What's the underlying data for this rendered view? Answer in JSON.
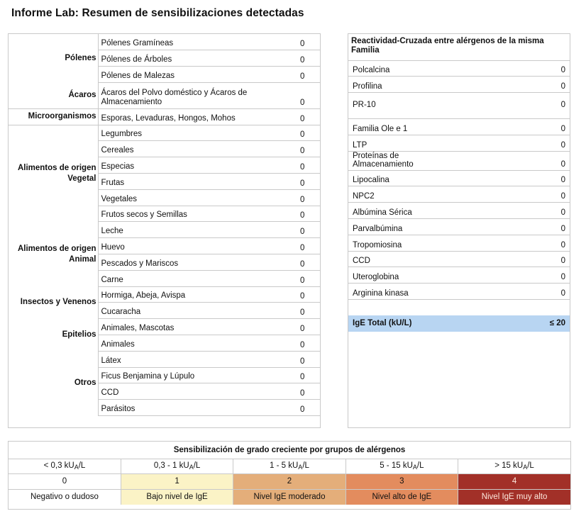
{
  "title": "Informe Lab: Resumen de sensibilizaciones detectadas",
  "left": {
    "rows": [
      {
        "cat": "",
        "sub": "Pólenes Gramíneas",
        "val": "0"
      },
      {
        "cat": "Pólenes",
        "sub": "Pólenes de Árboles",
        "val": "0"
      },
      {
        "cat": "",
        "sub": "Pólenes de Malezas",
        "val": "0"
      },
      {
        "cat": "Ácaros",
        "sub": "Ácaros del Polvo doméstico y Ácaros de Almacenamiento",
        "val": "0"
      },
      {
        "cat": "Microorganismos",
        "sub": "Esporas, Levaduras, Hongos, Mohos",
        "val": "0"
      },
      {
        "cat": "",
        "sub": "Legumbres",
        "val": "0"
      },
      {
        "cat": "",
        "sub": "Cereales",
        "val": "0"
      },
      {
        "cat": "Alimentos de origen Vegetal",
        "sub": "Especias",
        "val": "0"
      },
      {
        "cat": "",
        "sub": "Frutas",
        "val": "0"
      },
      {
        "cat": "",
        "sub": "Vegetales",
        "val": "0"
      },
      {
        "cat": "",
        "sub": "Frutos secos y Semillas",
        "val": "0"
      },
      {
        "cat": "",
        "sub": "Leche",
        "val": "0"
      },
      {
        "cat": "Alimentos de origen Animal",
        "sub": "Huevo",
        "val": "0"
      },
      {
        "cat": "",
        "sub": "Pescados y Mariscos",
        "val": "0"
      },
      {
        "cat": "",
        "sub": "Carne",
        "val": "0"
      },
      {
        "cat": "Insectos y Venenos",
        "sub": "Hormiga, Abeja, Avispa",
        "val": "0"
      },
      {
        "cat": "",
        "sub": "Cucaracha",
        "val": "0"
      },
      {
        "cat": "Epitelios",
        "sub": "Animales, Mascotas",
        "val": "0"
      },
      {
        "cat": "",
        "sub": "Animales",
        "val": "0"
      },
      {
        "cat": "",
        "sub": "Látex",
        "val": "0"
      },
      {
        "cat": "Otros",
        "sub": "Ficus Benjamina y Lúpulo",
        "val": "0"
      },
      {
        "cat": "",
        "sub": "CCD",
        "val": "0"
      },
      {
        "cat": "",
        "sub": "Parásitos",
        "val": "0"
      }
    ]
  },
  "right": {
    "header": "Reactividad-Cruzada entre alérgenos de la misma Familia",
    "rows": [
      {
        "name": "Polcalcina",
        "val": "0"
      },
      {
        "name": "Profilina",
        "val": "0"
      },
      {
        "name": "PR-10",
        "val": "0"
      },
      {
        "name": "Familia Ole e 1",
        "val": "0"
      },
      {
        "name": "LTP",
        "val": "0"
      },
      {
        "name": "Proteínas de Almacenamiento",
        "val": "0"
      },
      {
        "name": "Lipocalina",
        "val": "0"
      },
      {
        "name": "NPC2",
        "val": "0"
      },
      {
        "name": "Albúmina Sérica",
        "val": "0"
      },
      {
        "name": "Parvalbúmina",
        "val": "0"
      },
      {
        "name": "Tropomiosina",
        "val": "0"
      },
      {
        "name": "CCD",
        "val": "0"
      },
      {
        "name": "Uteroglobina",
        "val": "0"
      },
      {
        "name": "Arginina kinasa",
        "val": "0"
      }
    ],
    "total_label": "IgE Total (kU/L)",
    "total_value": "≤ 20"
  },
  "legend": {
    "title": "Sensibilización de grado creciente por grupos de alérgenos",
    "ranges": [
      {
        "pre": "< 0,3 kU",
        "sub": "A",
        "post": "/L"
      },
      {
        "pre": "0,3 - 1 kU",
        "sub": "A",
        "post": "/L"
      },
      {
        "pre": "1 - 5 kU",
        "sub": "A",
        "post": "/L"
      },
      {
        "pre": "5 - 15 kU",
        "sub": "A",
        "post": "/L"
      },
      {
        "pre": "> 15 kU",
        "sub": "A",
        "post": "/L"
      }
    ],
    "levels": [
      "0",
      "1",
      "2",
      "3",
      "4"
    ],
    "descriptions": [
      "Negativo o dudoso",
      "Bajo nivel de IgE",
      "Nivel IgE moderado",
      "Nivel alto de IgE",
      "Nivel IgE muy alto"
    ],
    "colors": [
      "#ffffff",
      "#fbf3c6",
      "#e4ae7a",
      "#e38c5e",
      "#a23028"
    ]
  }
}
